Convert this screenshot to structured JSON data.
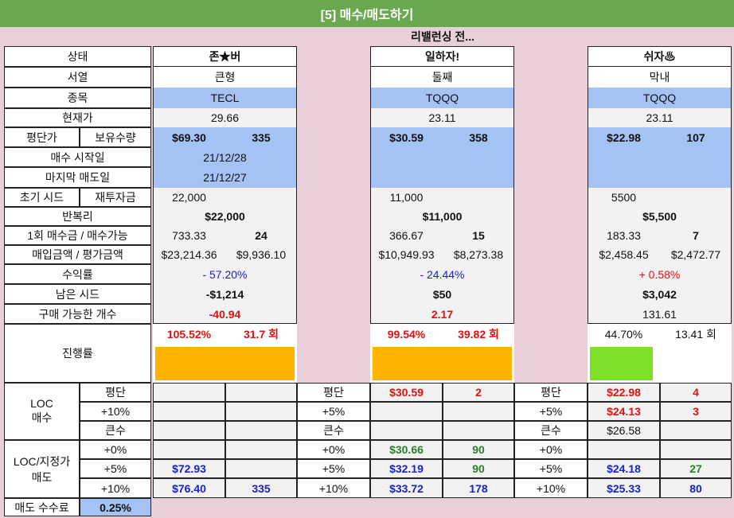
{
  "title": "[5] 매수/매도하기",
  "subtitle": "리밸런싱 전...",
  "labels": {
    "state": "상태",
    "order": "서열",
    "ticker": "종목",
    "price": "현재가",
    "avg": "평단가",
    "holding": "보유수량",
    "buy_start": "매수 시작일",
    "last_sell": "마지막 매도일",
    "init_seed": "초기 시드",
    "reinvest": "재투자금",
    "compound": "반복리",
    "per_buy": "1회 매수금 / 매수가능",
    "cost_eval": "매입금액 / 평가금액",
    "return": "수익률",
    "remaining": "남은 시드",
    "buyable": "구매 가능한 개수",
    "progress": "진행률",
    "loc_buy": "LOC\n매수",
    "loc_sell": "LOC/지정가\n매도",
    "fee": "매도 수수료",
    "fee_value": "0.25%"
  },
  "sublabels": {
    "avg": "평단",
    "p10": "+10%",
    "p5": "+5%",
    "big": "큰수",
    "p0": "+0%"
  },
  "accounts": [
    {
      "state": "존★버",
      "order": "큰형",
      "ticker": "TECL",
      "price": "29.66",
      "avg": "$69.30",
      "qty": "335",
      "buy_start": "21/12/28",
      "last_sell": "21/12/27",
      "seed": "22,000",
      "reinvest": "",
      "compound": "$22,000",
      "per_buy": "733.33",
      "buy_count": "24",
      "cost": "$23,214.36",
      "eval": "$9,936.10",
      "ret": "- 57.20%",
      "remain": "-$1,214",
      "buyable": "-40.94",
      "prog_pct": "105.52%",
      "prog_cnt": "31.7 회",
      "bar_fill": 1.0,
      "bar_color": "#ffb300",
      "loc_buy": [
        [
          "",
          ""
        ],
        [
          "",
          ""
        ],
        [
          "",
          ""
        ]
      ],
      "loc_sell": [
        [
          "",
          ""
        ],
        [
          "$72.93",
          ""
        ],
        [
          "$76.40",
          "335"
        ]
      ]
    },
    {
      "state": "일하자!",
      "order": "둘째",
      "ticker": "TQQQ",
      "price": "23.11",
      "avg": "$30.59",
      "qty": "358",
      "buy_start": "",
      "last_sell": "",
      "seed": "11,000",
      "reinvest": "",
      "compound": "$11,000",
      "per_buy": "366.67",
      "buy_count": "15",
      "cost": "$10,949.93",
      "eval": "$8,273.38",
      "ret": "- 24.44%",
      "remain": "$50",
      "buyable": "2.17",
      "prog_pct": "99.54%",
      "prog_cnt": "39.82 회",
      "bar_fill": 1.0,
      "bar_color": "#ffb300",
      "loc_buy": [
        [
          "$30.59",
          "2"
        ],
        [
          "",
          ""
        ],
        [
          "",
          ""
        ]
      ],
      "loc_sell": [
        [
          "$30.66",
          "90"
        ],
        [
          "$32.19",
          "90"
        ],
        [
          "$33.72",
          "178"
        ]
      ]
    },
    {
      "state": "쉬자♨",
      "order": "막내",
      "ticker": "TQQQ",
      "price": "23.11",
      "avg": "$22.98",
      "qty": "107",
      "buy_start": "",
      "last_sell": "",
      "seed": "5500",
      "reinvest": "",
      "compound": "$5,500",
      "per_buy": "183.33",
      "buy_count": "7",
      "cost": "$2,458.45",
      "eval": "$2,472.77",
      "ret": "+ 0.58%",
      "remain": "$3,042",
      "buyable": "131.61",
      "prog_pct": "44.70%",
      "prog_cnt": "13.41 회",
      "bar_fill": 0.45,
      "bar_color": "#7ee02b",
      "loc_buy": [
        [
          "$22.98",
          "4"
        ],
        [
          "$24.13",
          "3"
        ],
        [
          "$26.58",
          ""
        ]
      ],
      "loc_sell": [
        [
          "",
          ""
        ],
        [
          "$24.18",
          "27"
        ],
        [
          "$25.33",
          "80"
        ]
      ]
    }
  ]
}
